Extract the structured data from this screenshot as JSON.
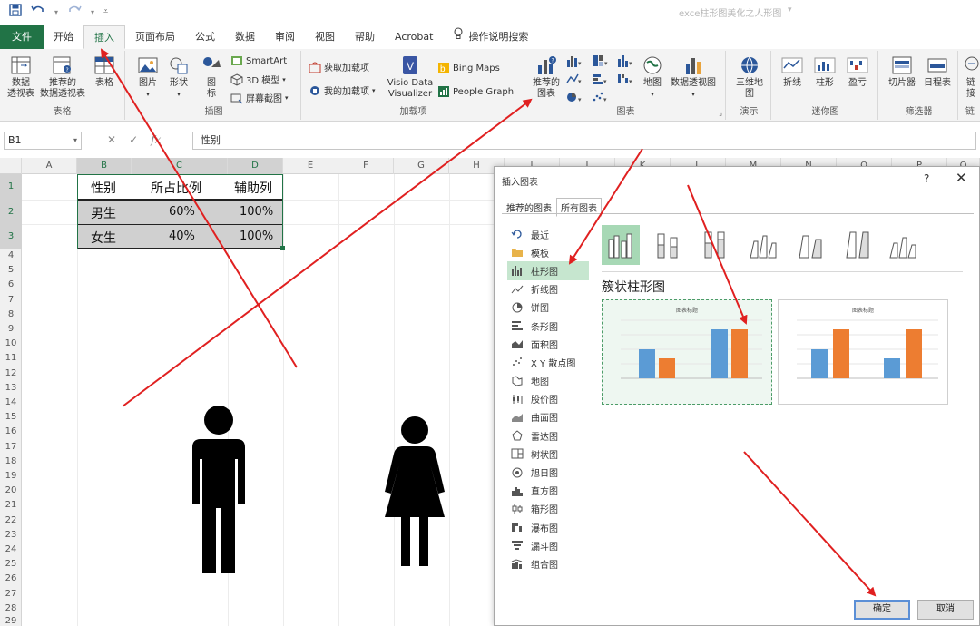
{
  "app": {
    "title": "exce柱形图美化之人形图"
  },
  "tabs": [
    "文件",
    "开始",
    "插入",
    "页面布局",
    "公式",
    "数据",
    "审阅",
    "视图",
    "帮助",
    "Acrobat",
    "操作说明搜索"
  ],
  "ribbon": {
    "groups": {
      "tables": "表格",
      "illustrations": "插图",
      "addins": "加载项",
      "charts": "图表",
      "tours": "演示",
      "sparklines": "迷你图",
      "filters": "筛选器",
      "links": "链"
    },
    "buttons": {
      "pivot_table": "数据\n透视表",
      "recommended_pivot": "推荐的\n数据透视表",
      "table": "表格",
      "pictures": "图片",
      "shapes": "形状",
      "icons": "图\n标",
      "smartart": "SmartArt",
      "models_3d": "3D 模型",
      "screenshot": "屏幕截图",
      "get_addins": "获取加载项",
      "my_addins": "我的加载项",
      "visio": "Visio Data\nVisualizer",
      "bing_maps": "Bing Maps",
      "people_graph": "People Graph",
      "recommended_charts": "推荐的\n图表",
      "maps": "地图",
      "pivot_chart": "数据透视图",
      "map_3d": "三维地\n图",
      "line": "折线",
      "column": "柱形",
      "win_loss": "盈亏",
      "slicer": "切片器",
      "timeline": "日程表",
      "link": "链\n接"
    }
  },
  "formula_bar": {
    "name_box": "B1",
    "fx": "fx",
    "content": "性别"
  },
  "sheet": {
    "columns": [
      "A",
      "B",
      "C",
      "D",
      "E",
      "F",
      "G",
      "H",
      "I",
      "J",
      "K",
      "L",
      "M",
      "N",
      "O",
      "P",
      "Q"
    ],
    "rows": [
      "1",
      "2",
      "3",
      "4",
      "5",
      "6",
      "7",
      "8",
      "9",
      "10",
      "11",
      "12",
      "13",
      "14",
      "15",
      "16",
      "17",
      "18",
      "19",
      "20",
      "21",
      "22",
      "23",
      "24",
      "25",
      "26",
      "27",
      "28",
      "29"
    ],
    "table": {
      "headers": [
        "性别",
        "所占比例",
        "辅助列"
      ],
      "rows": [
        [
          "男生",
          "60%",
          "100%"
        ],
        [
          "女生",
          "40%",
          "100%"
        ]
      ]
    }
  },
  "dialog": {
    "title": "插入图表",
    "help": "?",
    "close": "✕",
    "tabs": [
      "推荐的图表",
      "所有图表"
    ],
    "chart_types": [
      "最近",
      "模板",
      "柱形图",
      "折线图",
      "饼图",
      "条形图",
      "面积图",
      "X Y 散点图",
      "地图",
      "股价图",
      "曲面图",
      "雷达图",
      "树状图",
      "旭日图",
      "直方图",
      "箱形图",
      "瀑布图",
      "漏斗图",
      "组合图"
    ],
    "selected_type": "柱形图",
    "subtype_title": "簇状柱形图",
    "preview_title": "图表标题",
    "ok": "确定",
    "cancel": "取消"
  },
  "colors": {
    "excel_green": "#217346",
    "arrow_red": "#e02020",
    "bar_blue": "#5b9bd5",
    "bar_orange": "#ed7d31"
  },
  "icons": {
    "save": "save-icon",
    "undo": "undo-icon",
    "redo": "redo-icon",
    "lightbulb": "lightbulb-icon"
  }
}
